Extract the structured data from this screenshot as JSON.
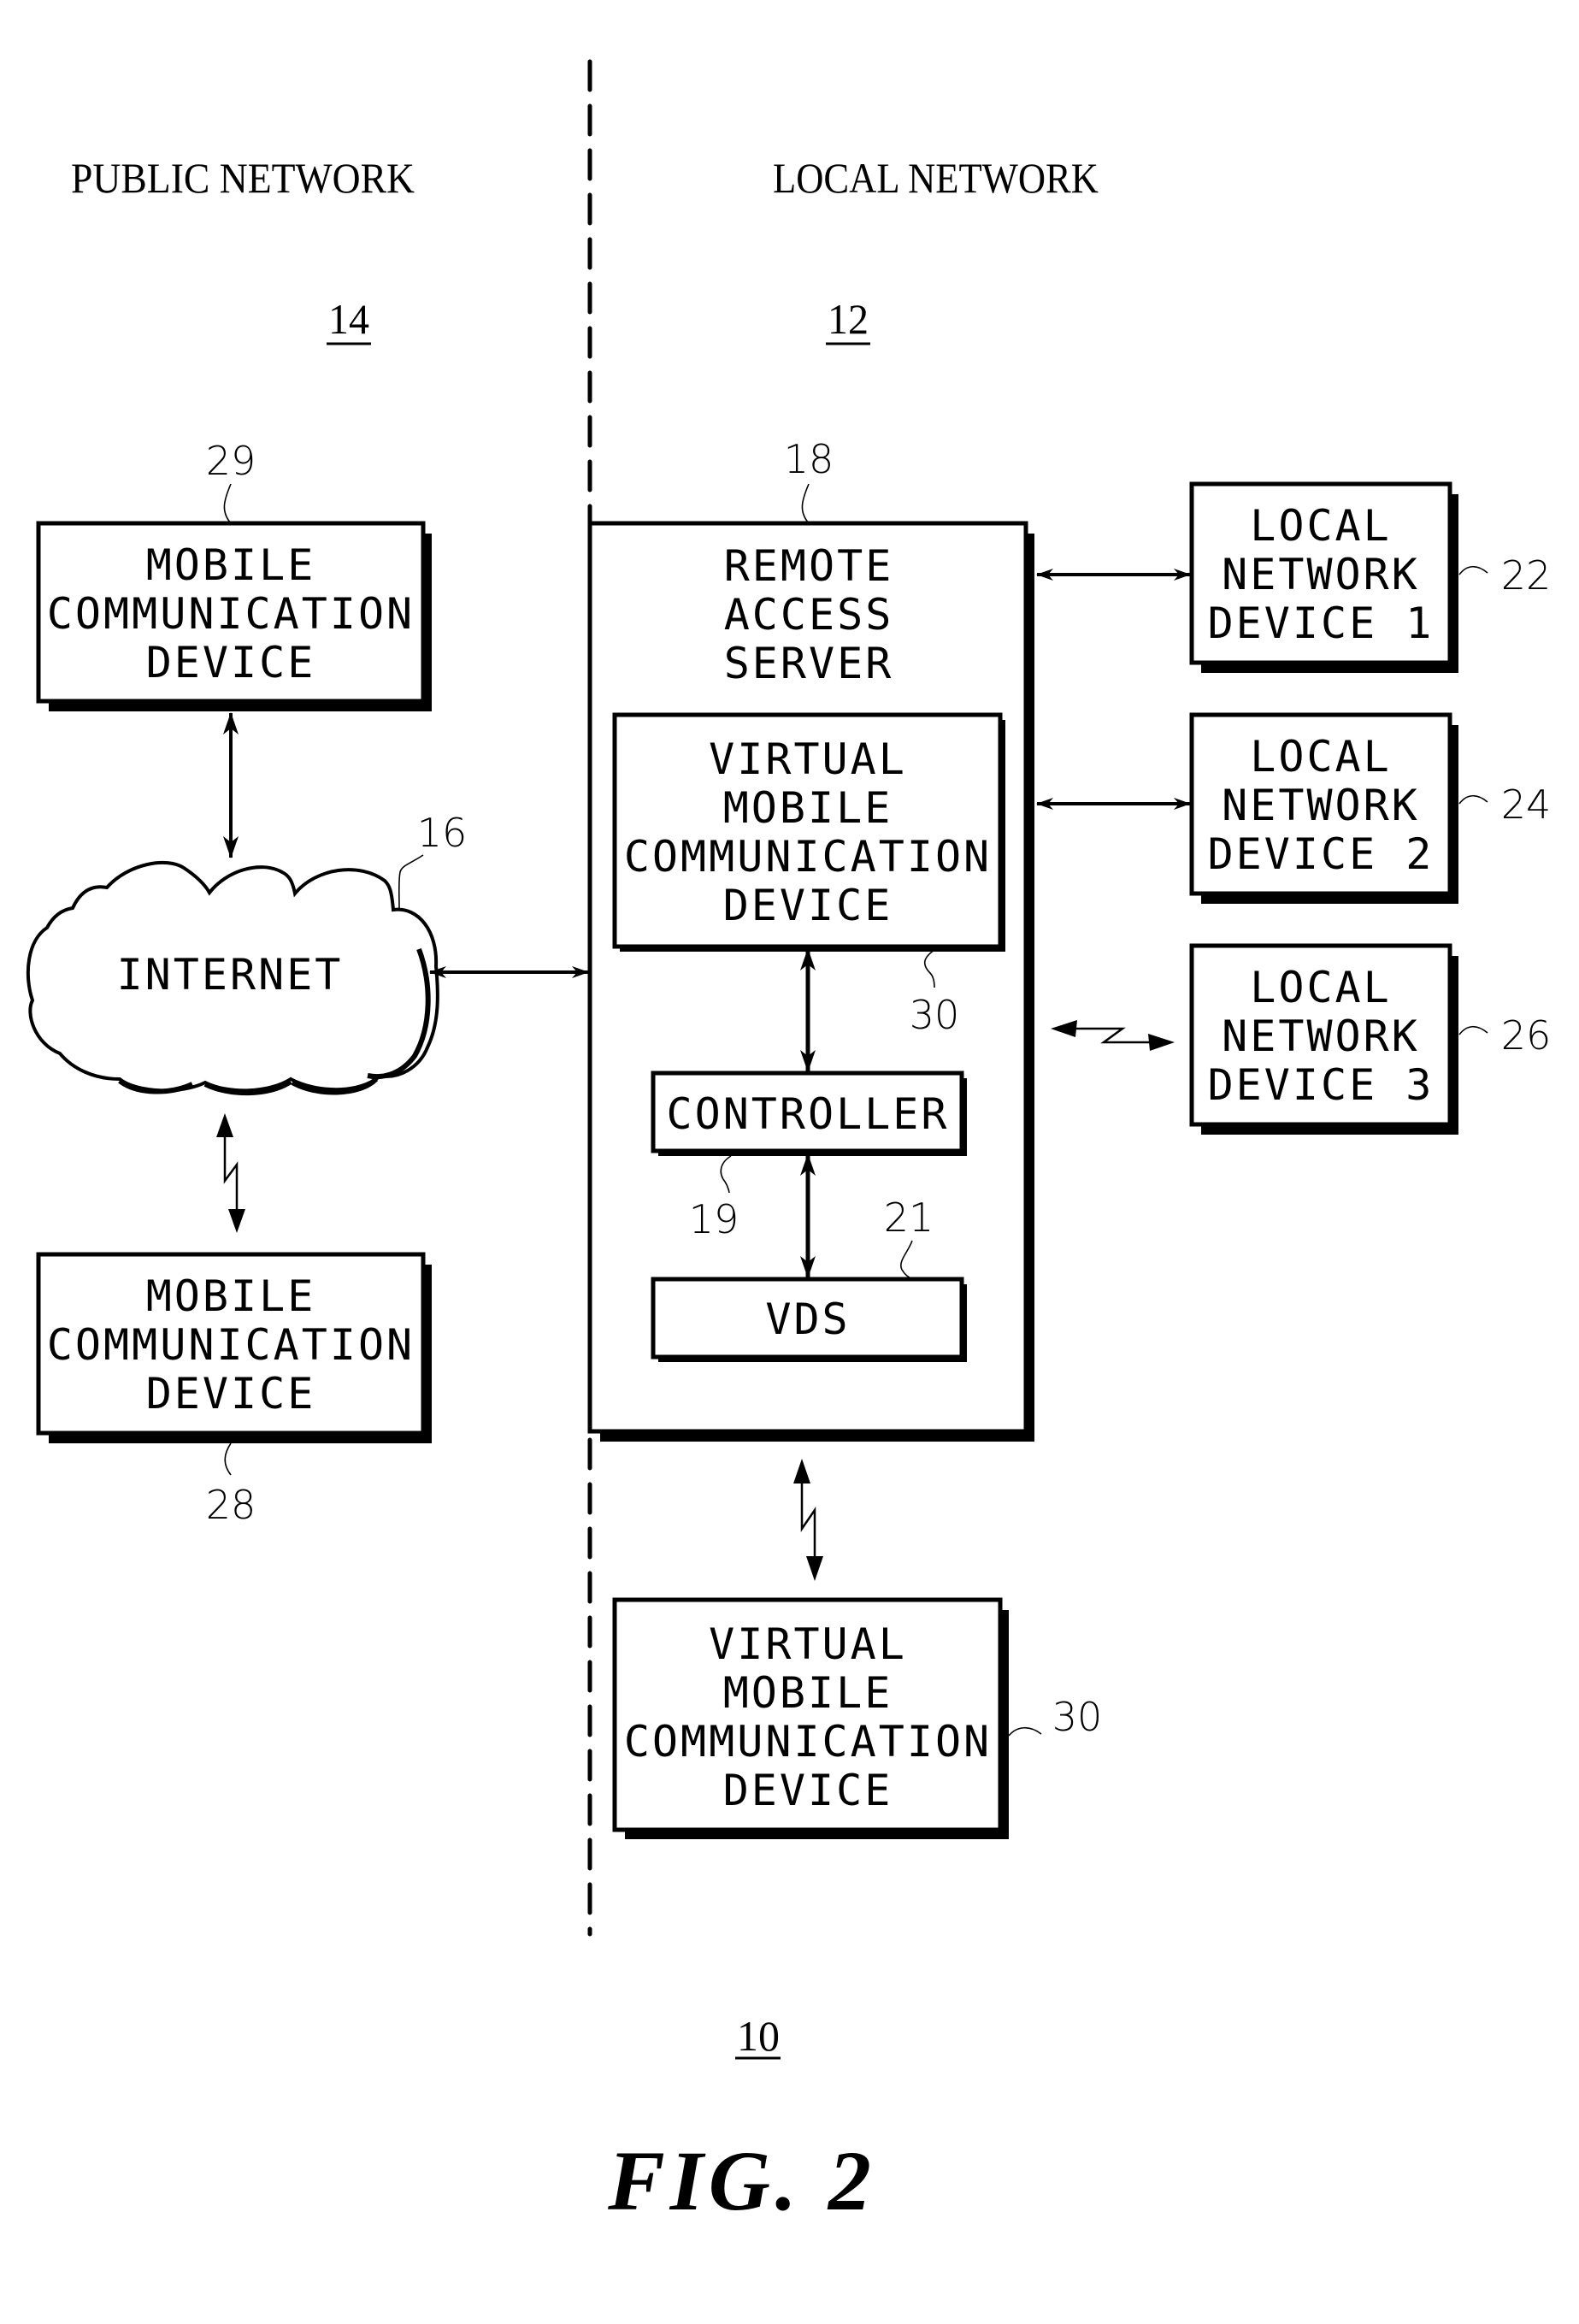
{
  "figure": {
    "caption": "FIG. 2",
    "system_ref": "10"
  },
  "regions": {
    "public": {
      "label": "PUBLIC NETWORK",
      "ref": "14"
    },
    "local": {
      "label": "LOCAL NETWORK",
      "ref": "12"
    }
  },
  "nodes": {
    "mobile_top": {
      "lines": [
        "MOBILE",
        "COMMUNICATION",
        "DEVICE"
      ],
      "ref": "29"
    },
    "internet": {
      "lines": [
        "INTERNET"
      ],
      "ref": "16"
    },
    "mobile_bottom": {
      "lines": [
        "MOBILE",
        "COMMUNICATION",
        "DEVICE"
      ],
      "ref": "28"
    },
    "server": {
      "lines": [
        "REMOTE",
        "ACCESS",
        "SERVER"
      ],
      "ref": "18"
    },
    "vmcd_inner": {
      "lines": [
        "VIRTUAL",
        "MOBILE",
        "COMMUNICATION",
        "DEVICE"
      ],
      "ref": "30"
    },
    "controller": {
      "lines": [
        "CONTROLLER"
      ],
      "ref": "19"
    },
    "vds": {
      "lines": [
        "VDS"
      ],
      "ref": "21"
    },
    "lnd1": {
      "lines": [
        "LOCAL",
        "NETWORK",
        "DEVICE 1"
      ],
      "ref": "22"
    },
    "lnd2": {
      "lines": [
        "LOCAL",
        "NETWORK",
        "DEVICE 2"
      ],
      "ref": "24"
    },
    "lnd3": {
      "lines": [
        "LOCAL",
        "NETWORK",
        "DEVICE 3"
      ],
      "ref": "26"
    },
    "vmcd_outer": {
      "lines": [
        "VIRTUAL",
        "MOBILE",
        "COMMUNICATION",
        "DEVICE"
      ],
      "ref": "30"
    }
  },
  "connections": [
    {
      "from": "mobile_top",
      "to": "internet",
      "kind": "wired-bidirectional"
    },
    {
      "from": "internet",
      "to": "mobile_bottom",
      "kind": "wireless-bidirectional"
    },
    {
      "from": "internet",
      "to": "server",
      "kind": "wired-bidirectional"
    },
    {
      "from": "server",
      "to": "lnd1",
      "kind": "wired-bidirectional"
    },
    {
      "from": "server",
      "to": "lnd2",
      "kind": "wired-bidirectional"
    },
    {
      "from": "server",
      "to": "lnd3",
      "kind": "wireless-bidirectional"
    },
    {
      "from": "vmcd_inner",
      "to": "controller",
      "kind": "wired-bidirectional"
    },
    {
      "from": "controller",
      "to": "vds",
      "kind": "wired-bidirectional"
    },
    {
      "from": "server",
      "to": "vmcd_outer",
      "kind": "wireless-bidirectional"
    }
  ]
}
